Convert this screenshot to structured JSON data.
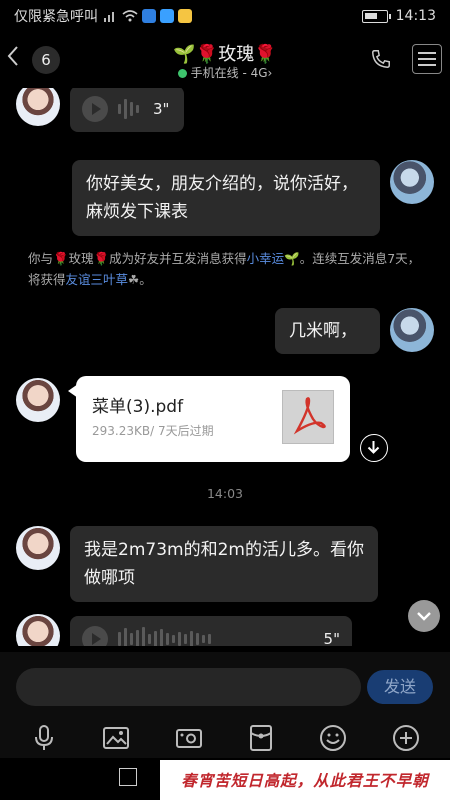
{
  "status_bar": {
    "carrier": "仅限紧急呼叫",
    "time": "14:13"
  },
  "header": {
    "unread_count": "6",
    "title": "🌱🌹玫瑰🌹",
    "subtitle_status": "手机在线 - 4G",
    "subtitle_chevron": "›"
  },
  "messages": {
    "voice_1": {
      "duration": "3\""
    },
    "sent_1": "你好美女，朋友介绍的，说你活好，麻烦发下课表",
    "system": {
      "part1": "你与🌹玫瑰🌹成为好友并互发消息获得",
      "link1": "小幸运",
      "part2": "🌱。连续互发消息7天，将获得",
      "link2": "友谊三叶草",
      "part3": "☘。"
    },
    "sent_2": "几米啊，",
    "file": {
      "name": "菜单(3).pdf",
      "meta": "293.23KB/ 7天后过期"
    },
    "timestamp": "14:03",
    "received_text": "我是2m73m的和2m的活儿多。看你做哪项",
    "voice_2": {
      "duration": "5\""
    }
  },
  "input": {
    "send_label": "发送"
  },
  "banner": {
    "text": "春宵苦短日高起，从此君王不早朝"
  }
}
